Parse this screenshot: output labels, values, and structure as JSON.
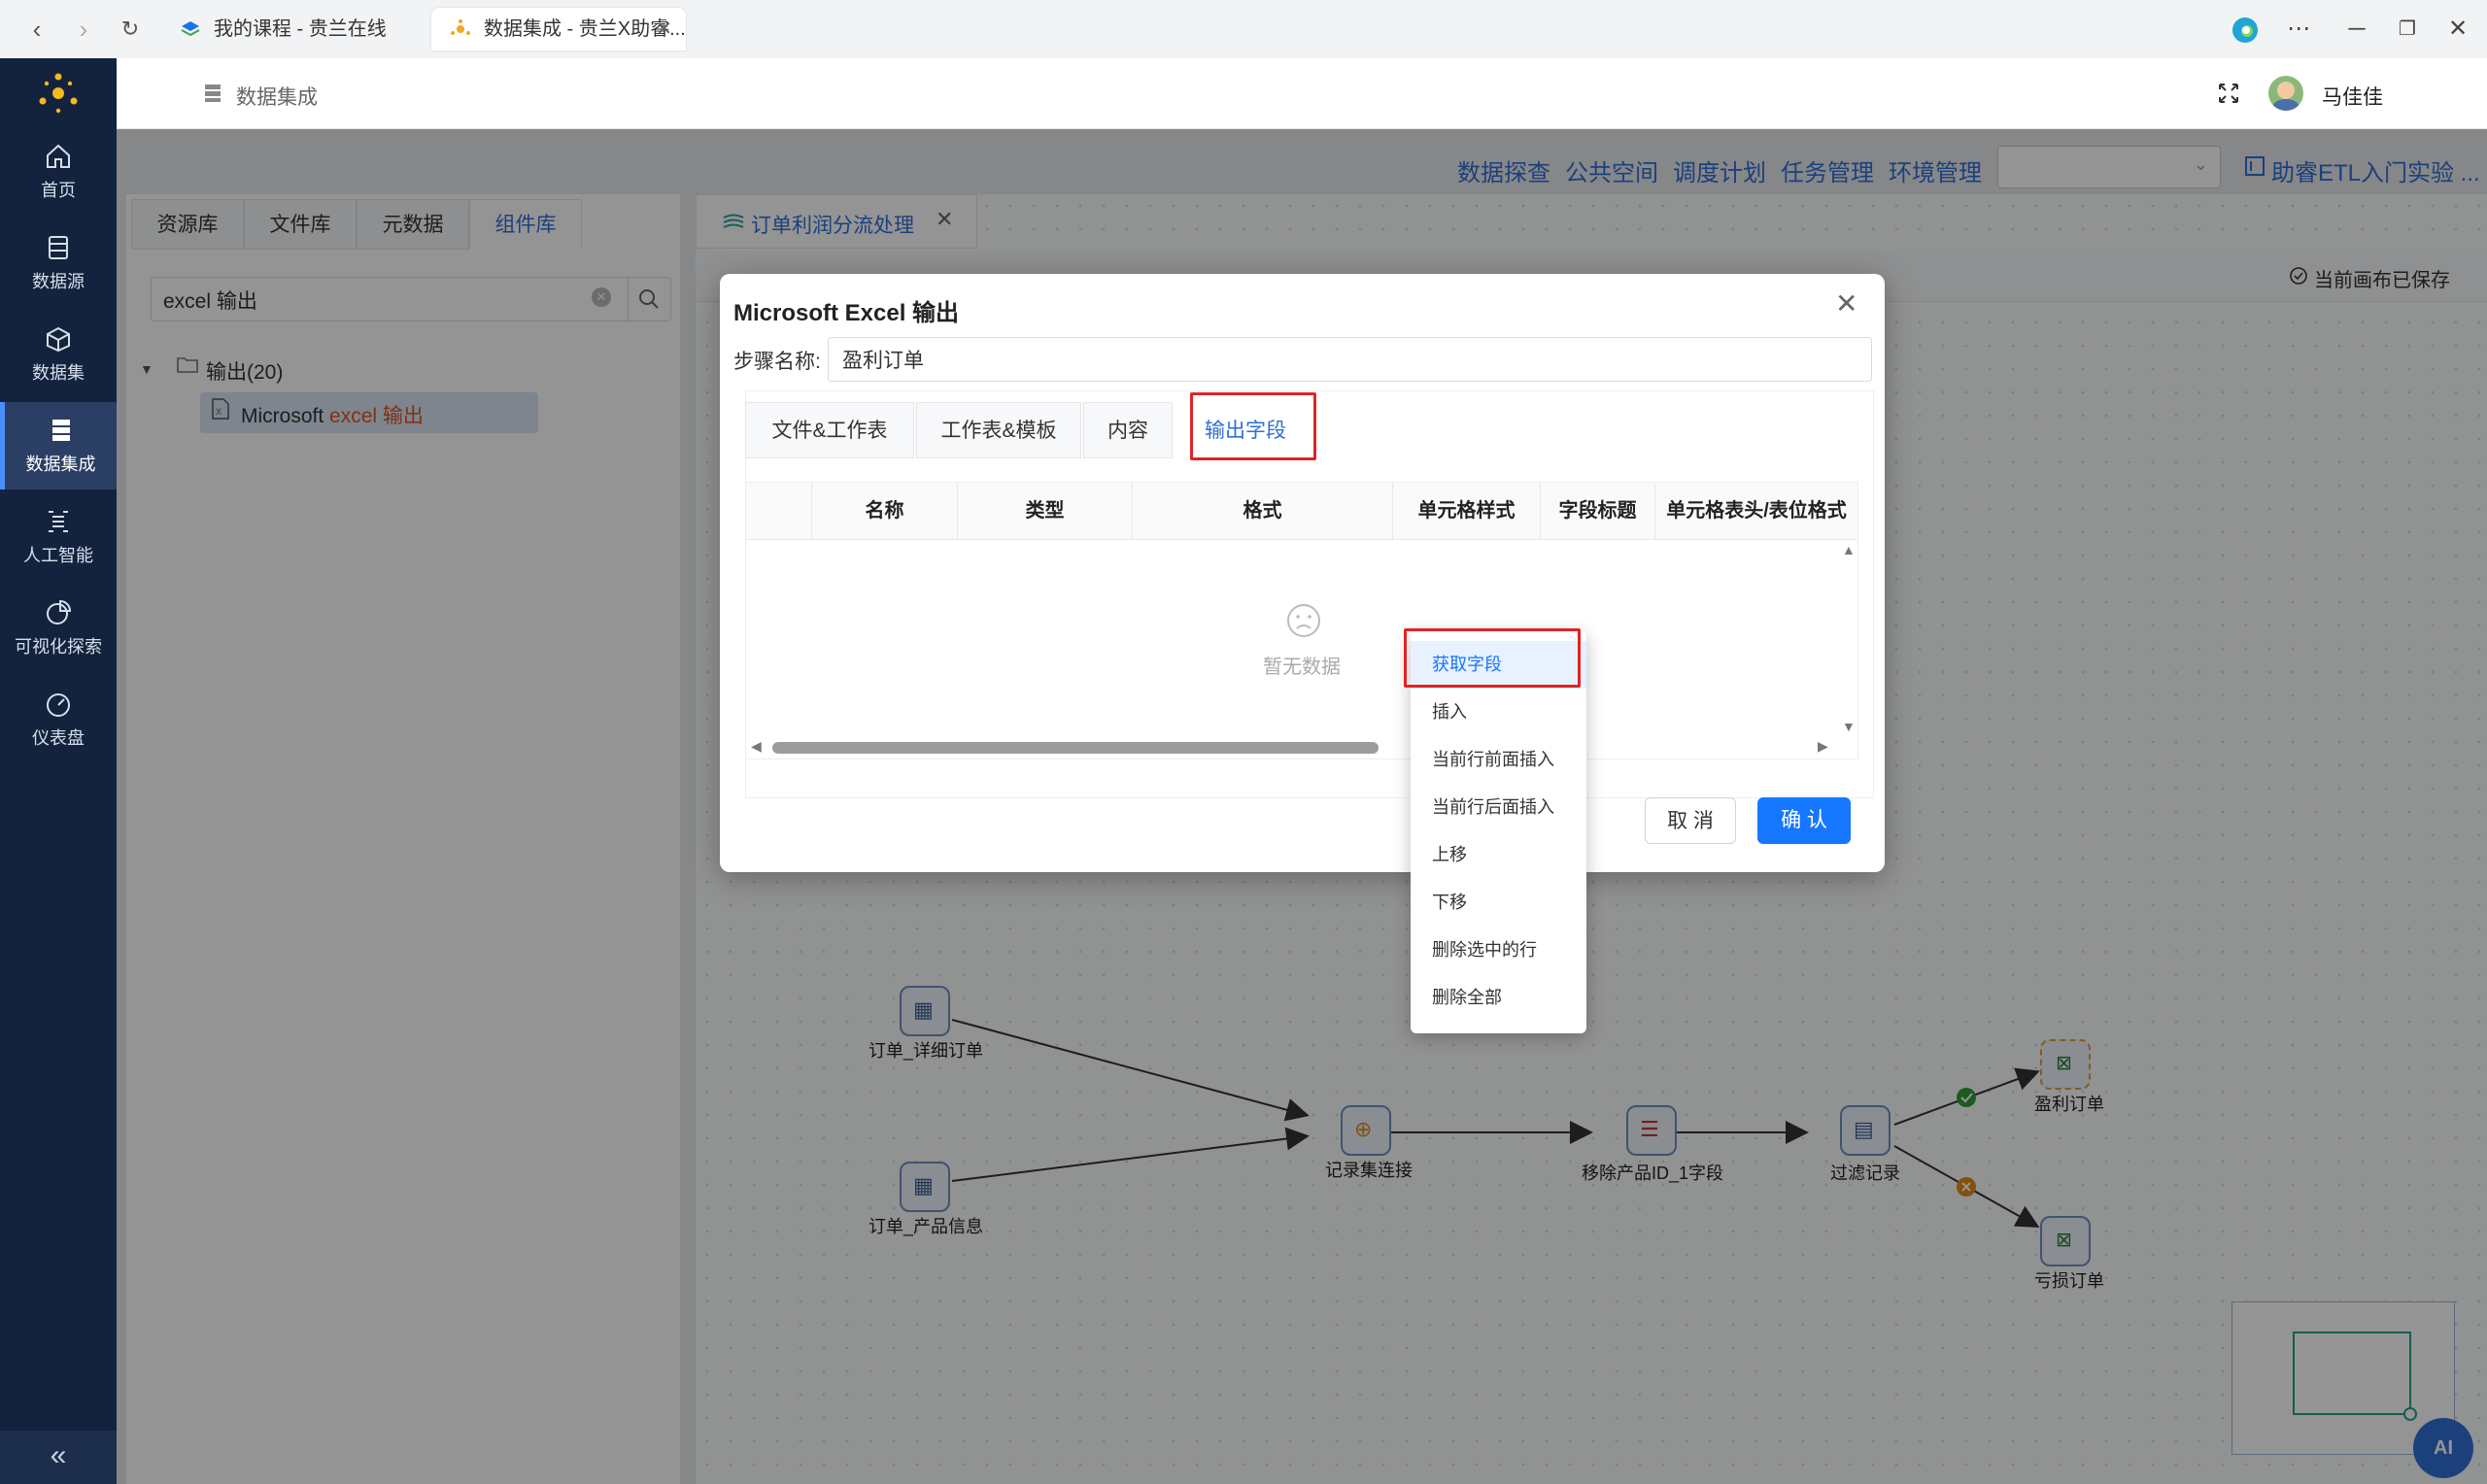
{
  "browser": {
    "tabs": [
      {
        "title": "我的课程 - 贵兰在线"
      },
      {
        "title": "数据集成 - 贵兰X助睿..."
      }
    ]
  },
  "sidebar": {
    "items": [
      {
        "label": "首页"
      },
      {
        "label": "数据源"
      },
      {
        "label": "数据集"
      },
      {
        "label": "数据集成"
      },
      {
        "label": "人工智能"
      },
      {
        "label": "可视化探索"
      },
      {
        "label": "仪表盘"
      }
    ],
    "collapse": "«"
  },
  "header": {
    "breadcrumb": "数据集成",
    "user_name": "马佳佳"
  },
  "toplinks": [
    "数据探查",
    "公共空间",
    "调度计划",
    "任务管理",
    "环境管理"
  ],
  "project_link": "助睿ETL入门实验 ...",
  "library": {
    "tabs": [
      "资源库",
      "文件库",
      "元数据",
      "组件库"
    ],
    "search_value": "excel 输出",
    "tree_group": "输出(20)",
    "tree_item_prefix": "Microsoft ",
    "tree_item_highlight": "excel 输出"
  },
  "canvas": {
    "tab_title": "订单利润分流处理",
    "saved_status": "当前画布已保存",
    "nodes": {
      "n1": "订单_详细订单",
      "n2": "订单_产品信息",
      "n3": "记录集连接",
      "n4": "移除产品ID_1字段",
      "n5": "过滤记录",
      "n6": "盈利订单",
      "n7": "亏损订单"
    },
    "ai_label": "AI"
  },
  "modal": {
    "title": "Microsoft Excel 输出",
    "step_label": "步骤名称:",
    "step_value": "盈利订单",
    "tabs": [
      "文件&工作表",
      "工作表&模板",
      "内容",
      "输出字段"
    ],
    "columns": [
      "名称",
      "类型",
      "格式",
      "单元格样式",
      "字段标题",
      "单元格表头/表位格式"
    ],
    "empty_text": "暂无数据",
    "cancel": "取 消",
    "confirm": "确 认"
  },
  "context_menu": {
    "items": [
      "获取字段",
      "插入",
      "当前行前面插入",
      "当前行后面插入",
      "上移",
      "下移",
      "删除选中的行",
      "删除全部"
    ]
  }
}
